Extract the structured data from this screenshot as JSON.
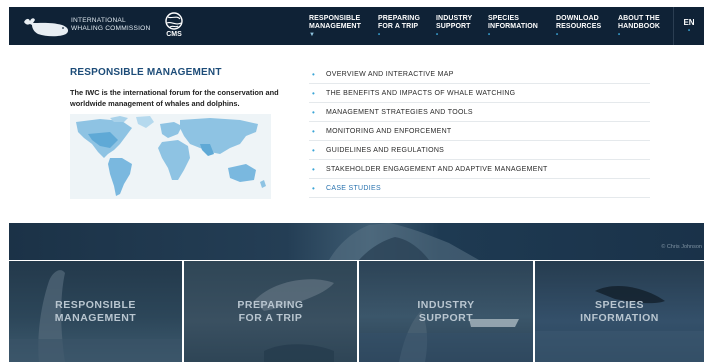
{
  "header": {
    "org_line1": "INTERNATIONAL",
    "org_line2": "WHALING COMMISSION",
    "partner": "CMS",
    "nav": [
      {
        "line1": "RESPONSIBLE",
        "line2": "MANAGEMENT"
      },
      {
        "line1": "PREPARING",
        "line2": "FOR A TRIP"
      },
      {
        "line1": "INDUSTRY",
        "line2": "SUPPORT"
      },
      {
        "line1": "SPECIES",
        "line2": "INFORMATION"
      },
      {
        "line1": "DOWNLOAD",
        "line2": "RESOURCES"
      },
      {
        "line1": "ABOUT THE",
        "line2": "HANDBOOK"
      }
    ],
    "language": "EN"
  },
  "dropdown": {
    "title": "RESPONSIBLE MANAGEMENT",
    "description": "The IWC is the international forum for the conservation and worldwide management of whales and dolphins.",
    "menu": [
      "OVERVIEW AND INTERACTIVE MAP",
      "THE BENEFITS AND IMPACTS OF WHALE WATCHING",
      "MANAGEMENT STRATEGIES AND TOOLS",
      "MONITORING AND ENFORCEMENT",
      "GUIDELINES AND REGULATIONS",
      "STAKEHOLDER ENGAGEMENT AND ADAPTIVE MANAGEMENT",
      "CASE STUDIES"
    ]
  },
  "hero": {
    "credit": "© Chris Johnson"
  },
  "tiles": [
    {
      "line1": "RESPONSIBLE",
      "line2": "MANAGEMENT"
    },
    {
      "line1": "PREPARING",
      "line2": "FOR A TRIP"
    },
    {
      "line1": "INDUSTRY",
      "line2": "SUPPORT"
    },
    {
      "line1": "SPECIES",
      "line2": "INFORMATION"
    }
  ],
  "colors": {
    "header_bg": "#0f2236",
    "accent": "#3aa5d6",
    "title": "#1d4c78",
    "map_land": "#8ec3e3"
  }
}
